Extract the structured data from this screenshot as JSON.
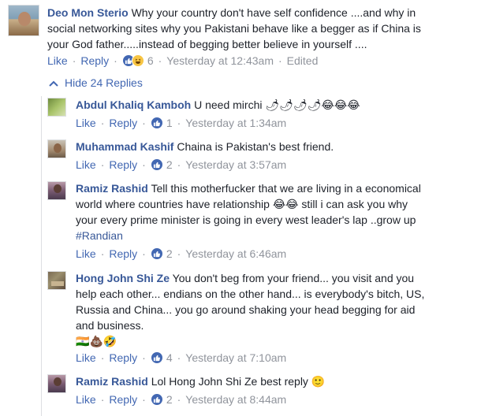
{
  "colors": {
    "link": "#4267b2",
    "name": "#385898",
    "text": "#1d2129",
    "meta": "#90949c"
  },
  "main_comment": {
    "author": "Deo Mon Sterio",
    "text_lines": [
      "Why your country don't have self confidence ....and why in",
      "social networking sites why you Pakistani behave like a begger as if China is",
      "your God father.....instead of begging better believe in yourself ...."
    ],
    "like_label": "Like",
    "reply_label": "Reply",
    "reactions": [
      "like-icon",
      "haha-icon"
    ],
    "reaction_count": "6",
    "time": "Yesterday at 12:43am",
    "edited": "Edited"
  },
  "hide_replies": {
    "label": "Hide 24 Replies",
    "icon": "chevron-up-icon"
  },
  "replies": [
    {
      "author": "Abdul Khaliq Kamboh",
      "text_lines": [
        "U need mirchi"
      ],
      "emojis": [
        "🌶",
        "🌶",
        "🌶",
        "🌶",
        "😂",
        "😂",
        "😂"
      ],
      "like_label": "Like",
      "reply_label": "Reply",
      "reaction_count": "1",
      "time": "Yesterday at 1:34am"
    },
    {
      "author": "Muhammad Kashif",
      "text_lines": [
        "Chaina is Pakistan's best friend."
      ],
      "like_label": "Like",
      "reply_label": "Reply",
      "reaction_count": "2",
      "time": "Yesterday at 3:57am"
    },
    {
      "author": "Ramiz Rashid",
      "text_lines": [
        "Tell this motherfucker that we are living in a economical",
        "world where countries have relationship",
        "still i can ask you why",
        "your every prime minister is going in every west leader's lap ..grow up"
      ],
      "hashtag": "#Randian",
      "emojis": [
        "😂",
        "😂"
      ],
      "like_label": "Like",
      "reply_label": "Reply",
      "reaction_count": "2",
      "time": "Yesterday at 6:46am"
    },
    {
      "author": "Hong John Shi Ze",
      "text_lines": [
        "You don't beg from your friend... you visit and you",
        "help each other... endians on the other hand... is everybody's bitch, US,",
        "Russia and China... you go around shaking your head begging for aid",
        "and business."
      ],
      "emojis": [
        "🇮🇳",
        "💩",
        "🤣"
      ],
      "like_label": "Like",
      "reply_label": "Reply",
      "reaction_count": "4",
      "time": "Yesterday at 7:10am"
    },
    {
      "author": "Ramiz Rashid",
      "text_lines": [
        "Lol Hong John Shi Ze best reply"
      ],
      "emojis": [
        "🙂"
      ],
      "like_label": "Like",
      "reply_label": "Reply",
      "reaction_count": "2",
      "time": "Yesterday at 8:44am"
    }
  ]
}
